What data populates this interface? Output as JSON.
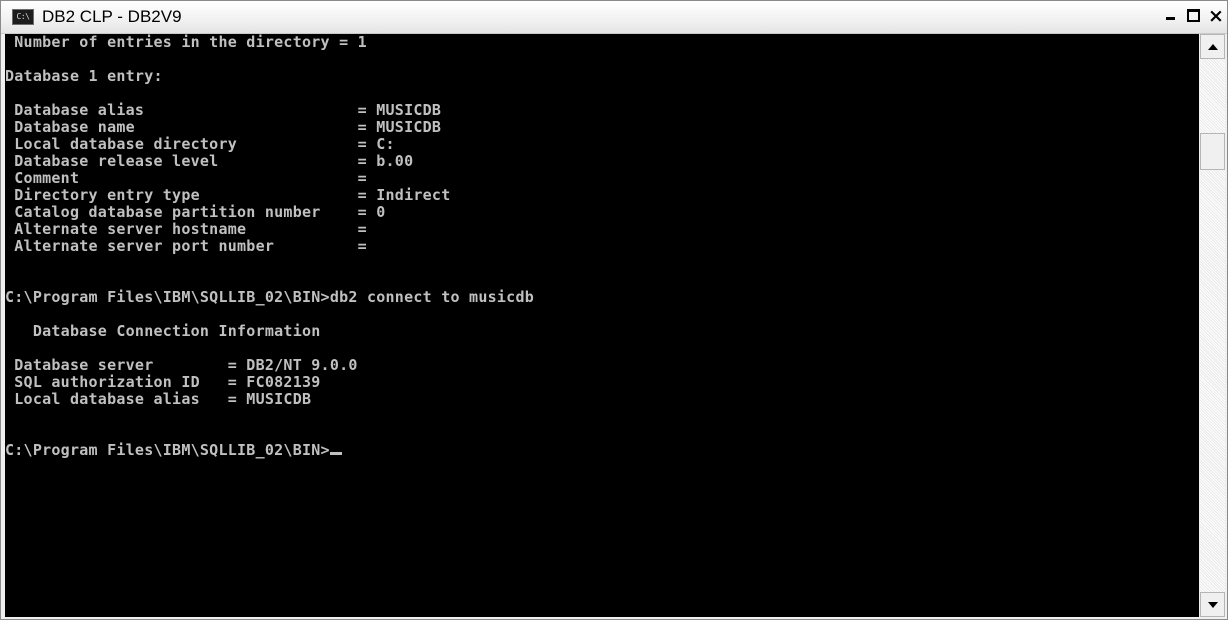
{
  "window": {
    "title": "DB2 CLP - DB2V9",
    "icon_text": "C:\\",
    "icon": "console-icon",
    "buttons": {
      "minimize": "minimize-icon",
      "maximize": "maximize-icon",
      "close_label": "×"
    }
  },
  "console": {
    "lines": [
      " Number of entries in the directory = 1",
      "",
      "Database 1 entry:",
      "",
      " Database alias                       = MUSICDB",
      " Database name                        = MUSICDB",
      " Local database directory             = C:",
      " Database release level               = b.00",
      " Comment                              =",
      " Directory entry type                 = Indirect",
      " Catalog database partition number    = 0",
      " Alternate server hostname            =",
      " Alternate server port number         =",
      "",
      "",
      "C:\\Program Files\\IBM\\SQLLIB_02\\BIN>db2 connect to musicdb",
      "",
      "   Database Connection Information",
      "",
      " Database server        = DB2/NT 9.0.0",
      " SQL authorization ID   = FC082139",
      " Local database alias   = MUSICDB",
      "",
      "",
      "C:\\Program Files\\IBM\\SQLLIB_02\\BIN>"
    ]
  },
  "scrollbar": {
    "up_icon": "scroll-up-arrow-icon",
    "down_icon": "scroll-down-arrow-icon"
  },
  "colors": {
    "console_bg": "#000000",
    "console_text": "#c0c0c0"
  }
}
